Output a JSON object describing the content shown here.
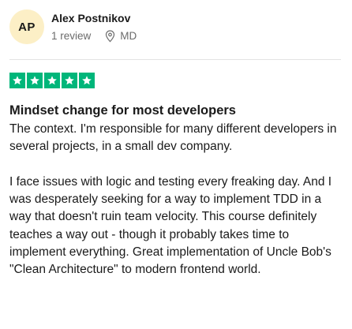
{
  "reviewer": {
    "initials": "AP",
    "name": "Alex Postnikov",
    "review_count": "1 review",
    "location": "MD",
    "avatar_color": "#fcefc6"
  },
  "rating": {
    "stars": 5,
    "max": 5,
    "star_color": "#00b67a",
    "icon": "star-icon"
  },
  "review": {
    "title": "Mindset change for most developers",
    "paragraphs": [
      "The context. I'm responsible for many different developers in several projects, in a small dev company.",
      "I face issues with logic and testing every freaking day. And I was desperately seeking for a way to implement TDD in a way that doesn't ruin team velocity. This course definitely teaches a way out - though it probably takes time to implement everything. Great implementation of Uncle Bob's \"Clean Architecture\" to modern frontend world."
    ]
  }
}
